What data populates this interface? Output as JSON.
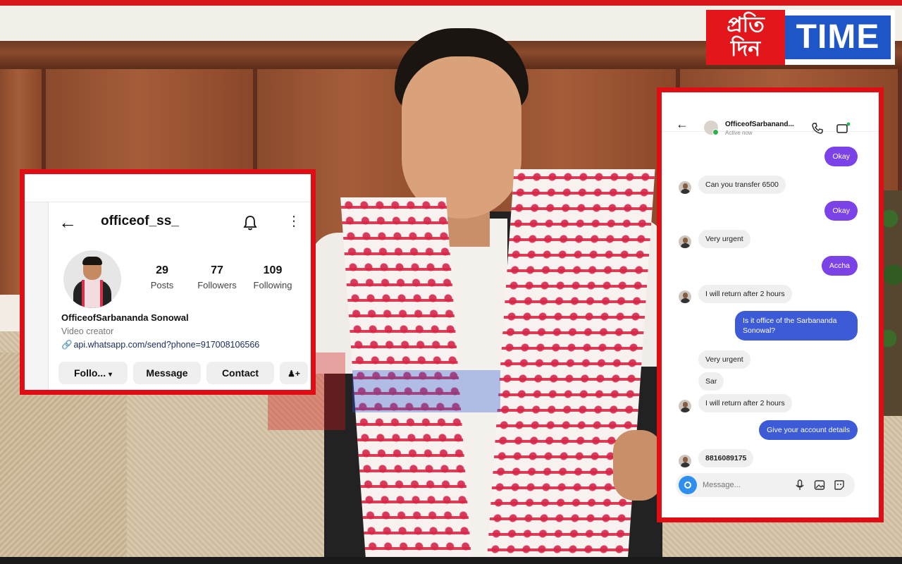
{
  "logo": {
    "left_text": "প্ৰতি\nদিন",
    "right_text": "TIME"
  },
  "profile": {
    "username": "officeof_ss_",
    "stats": [
      {
        "value": "29",
        "label": "Posts"
      },
      {
        "value": "77",
        "label": "Followers"
      },
      {
        "value": "109",
        "label": "Following"
      }
    ],
    "display_name": "OfficeofSarbananda Sonowal",
    "category": "Video creator",
    "link": "api.whatsapp.com/send?phone=917008106566",
    "buttons": {
      "follow": "Follo...",
      "message": "Message",
      "contact": "Contact"
    }
  },
  "chat": {
    "contact_name": "OfficeofSarbanand...",
    "contact_status": "Active now",
    "messages": [
      {
        "dir": "out",
        "text": "Okay"
      },
      {
        "dir": "in",
        "text": "Can you transfer 6500"
      },
      {
        "dir": "out",
        "text": "Okay"
      },
      {
        "dir": "in",
        "text": "Very urgent"
      },
      {
        "dir": "out",
        "text": "Accha"
      },
      {
        "dir": "in",
        "text": "I will return after 2 hours"
      },
      {
        "dir": "out",
        "text": "Is it office of the Sarbananda Sonowal?"
      },
      {
        "dir": "in",
        "text": "Very urgent"
      },
      {
        "dir": "in",
        "text": "Sar"
      },
      {
        "dir": "in",
        "text": "I will return after 2 hours"
      },
      {
        "dir": "out",
        "text": "Give your account details"
      },
      {
        "dir": "in",
        "text": "8816089175"
      }
    ],
    "composer_placeholder": "Message..."
  },
  "colors": {
    "frame_red": "#e00e14",
    "brand_blue": "#1e56c7",
    "bubble_purple": "#7b42e8",
    "bubble_blue": "#3d5bd6"
  }
}
